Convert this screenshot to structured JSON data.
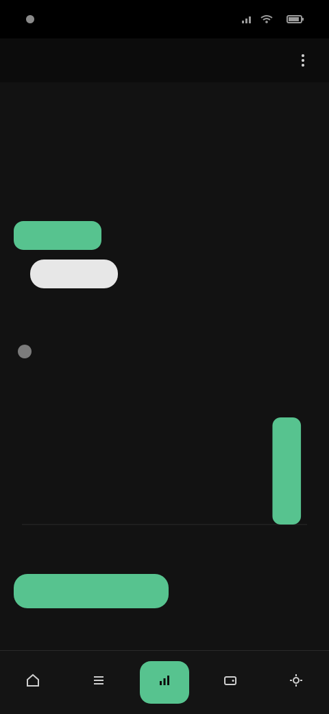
{
  "status_bar": {
    "time": "",
    "battery": ""
  },
  "app_bar": {
    "title": ""
  },
  "summary": {
    "title": "",
    "items": [
      {
        "label": "",
        "value": ""
      },
      {
        "label": "",
        "value": ""
      },
      {
        "label": "",
        "value": ""
      },
      {
        "label": "",
        "value": ""
      }
    ]
  },
  "tabs_top": [
    {
      "label": "",
      "active": true
    },
    {
      "label": "",
      "active": false
    },
    {
      "label": "",
      "active": false
    },
    {
      "label": "",
      "active": false
    }
  ],
  "filters": [
    {
      "label": "",
      "active": true
    },
    {
      "label": "",
      "active": false
    },
    {
      "label": "",
      "active": false
    }
  ],
  "caption": "",
  "chart_card": {
    "title": "",
    "subtitle": "",
    "meta": ""
  },
  "chart_data": {
    "type": "bar",
    "categories": [
      "",
      "",
      "",
      "",
      "",
      "",
      ""
    ],
    "values": [
      0,
      0,
      0,
      0,
      0,
      0,
      100
    ],
    "title": "",
    "xlabel": "",
    "ylabel": "",
    "ylim": [
      0,
      100
    ]
  },
  "bottom_tabs": [
    {
      "label": "",
      "active": true
    },
    {
      "label": "",
      "active": false
    }
  ],
  "bottom_nav": [
    {
      "label": "",
      "icon": "home-icon",
      "active": false
    },
    {
      "label": "",
      "icon": "list-icon",
      "active": false
    },
    {
      "label": "",
      "icon": "chart-icon",
      "active": true
    },
    {
      "label": "",
      "icon": "wallet-icon",
      "active": false
    },
    {
      "label": "",
      "icon": "settings-icon",
      "active": false
    }
  ]
}
